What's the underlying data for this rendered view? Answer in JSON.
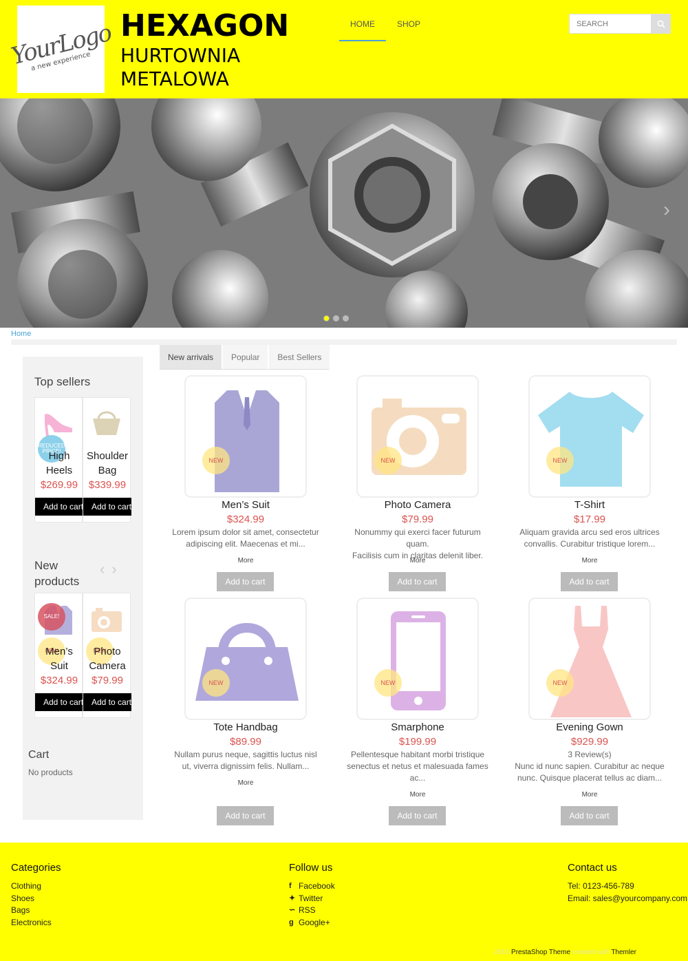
{
  "header": {
    "logo_script": "YourLogo",
    "logo_tagline": "a new experience",
    "brand_line1": "HEXAGON",
    "brand_line2": "HURTOWNIA",
    "brand_line3": "METALOWA",
    "nav": [
      {
        "label": "HOME"
      },
      {
        "label": "SHOP"
      }
    ],
    "search_placeholder": "SEARCH"
  },
  "breadcrumb": "Home",
  "sidebar": {
    "top_sellers_title": "Top sellers",
    "top_sellers": [
      {
        "name_1": "High",
        "name_2": "Heels",
        "price": "$269.99",
        "badge": "REDUCED PRICE!",
        "cta": "Add to cart"
      },
      {
        "name_1": "Shoulder",
        "name_2": "Bag",
        "price": "$339.99",
        "cta": "Add to cart"
      }
    ],
    "new_products_title_1": "New",
    "new_products_title_2": "products",
    "new_products": [
      {
        "name_1": "Men’s",
        "name_2": "Suit",
        "price": "$324.99",
        "badge": "SALE!",
        "badge2": "NEW",
        "cta": "Add to cart"
      },
      {
        "name_1": "Photo",
        "name_2": "Camera",
        "price": "$79.99",
        "badge2": "NEW",
        "cta": "Add to cart"
      }
    ],
    "cart_title": "Cart",
    "cart_empty": "No products"
  },
  "tabs": [
    {
      "label": "New arrivals"
    },
    {
      "label": "Popular"
    },
    {
      "label": "Best Sellers"
    }
  ],
  "products": [
    {
      "name": "Men’s Suit",
      "price": "$324.99",
      "desc_1": "Lorem ipsum dolor sit amet, consectetur",
      "desc_2": "adipiscing elit. Maecenas et mi...",
      "more": "More",
      "cta": "Add to cart",
      "badge": "NEW",
      "icon": "suit-icon",
      "color": "#a9a6d6"
    },
    {
      "name": "Photo Camera",
      "price": "$79.99",
      "desc_1": "Nonummy qui exerci facer futurum quam.",
      "desc_2": "Facilisis cum in claritas delenit liber.",
      "more": "More",
      "cta": "Add to cart",
      "badge": "NEW",
      "icon": "camera-icon",
      "color": "#f5dcc0"
    },
    {
      "name": "T-Shirt",
      "price": "$17.99",
      "desc_1": "Aliquam gravida arcu sed eros ultrices",
      "desc_2": "convallis. Curabitur tristique lorem...",
      "more": "More",
      "cta": "Add to cart",
      "badge": "NEW",
      "icon": "tshirt-icon",
      "color": "#a3ddf0"
    },
    {
      "name": "Tote Handbag",
      "price": "$89.99",
      "desc_1": "Nullam purus neque, sagittis luctus nisl",
      "desc_2": "ut, viverra dignissim felis. Nullam...",
      "more": "More",
      "cta": "Add to cart",
      "badge": "NEW",
      "icon": "handbag-icon",
      "color": "#b0a8dc"
    },
    {
      "name": "Smarphone",
      "price": "$199.99",
      "desc_1": "Pellentesque habitant morbi tristique",
      "desc_2": "senectus et netus et malesuada fames",
      "desc_3": "ac...",
      "more": "More",
      "cta": "Add to cart",
      "badge": "NEW",
      "icon": "smartphone-icon",
      "color": "#dcb2e6"
    },
    {
      "name": "Evening Gown",
      "price": "$929.99",
      "reviews": "3 Review(s)",
      "desc_1": "Nunc id nunc sapien. Curabitur ac neque",
      "desc_2": "nunc. Quisque placerat tellus ac diam...",
      "more": "More",
      "cta": "Add to cart",
      "badge": "NEW",
      "icon": "dress-icon",
      "color": "#f9c6c6"
    }
  ],
  "footer": {
    "categories_title": "Categories",
    "categories": [
      {
        "label": "Clothing"
      },
      {
        "label": "Shoes"
      },
      {
        "label": "Bags"
      },
      {
        "label": "Electronics"
      }
    ],
    "follow_title": "Follow us",
    "follow": [
      {
        "label": "Facebook",
        "icon": "facebook-icon"
      },
      {
        "label": "Twitter",
        "icon": "twitter-icon"
      },
      {
        "label": "RSS",
        "icon": "rss-icon"
      },
      {
        "label": "Google+",
        "icon": "googleplus-icon"
      }
    ],
    "contact_title": "Contact us",
    "tel": "Tel: 0123-456-789",
    "email": "Email: sales@yourcompany.com",
    "credits_1": "2016",
    "credits_2": "PrestaShop Theme",
    "credits_3": "created with",
    "credits_4": "Themler"
  },
  "colors": {
    "brand_yellow": "#ffff00",
    "price_red": "#d9534f",
    "nav_accent": "#4aa3d8"
  }
}
